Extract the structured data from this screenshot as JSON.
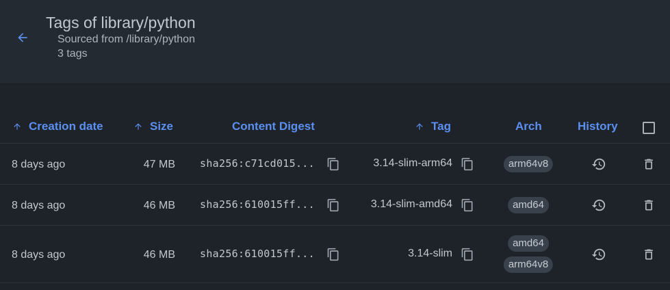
{
  "header": {
    "title": "Tags of library/python",
    "subtitle": "Sourced from /library/python",
    "count": "3 tags"
  },
  "columns": {
    "creation_date": "Creation date",
    "size": "Size",
    "content_digest": "Content Digest",
    "tag": "Tag",
    "arch": "Arch",
    "history": "History"
  },
  "rows": [
    {
      "date": "8 days ago",
      "size": "47 MB",
      "digest": "sha256:c71cd015...",
      "tag": "3.14-slim-arm64",
      "arch": [
        "arm64v8"
      ]
    },
    {
      "date": "8 days ago",
      "size": "46 MB",
      "digest": "sha256:610015ff...",
      "tag": "3.14-slim-amd64",
      "arch": [
        "amd64"
      ]
    },
    {
      "date": "8 days ago",
      "size": "46 MB",
      "digest": "sha256:610015ff...",
      "tag": "3.14-slim",
      "arch": [
        "amd64",
        "arm64v8"
      ]
    }
  ],
  "colors": {
    "accent": "#5b8ff0",
    "background": "#1e2329",
    "header_background": "#232a31",
    "chip": "#39414d"
  },
  "icons": {
    "back": "arrow-left-icon",
    "sort": "arrow-up-icon",
    "copy": "copy-icon",
    "history": "history-icon",
    "delete": "trash-icon"
  }
}
